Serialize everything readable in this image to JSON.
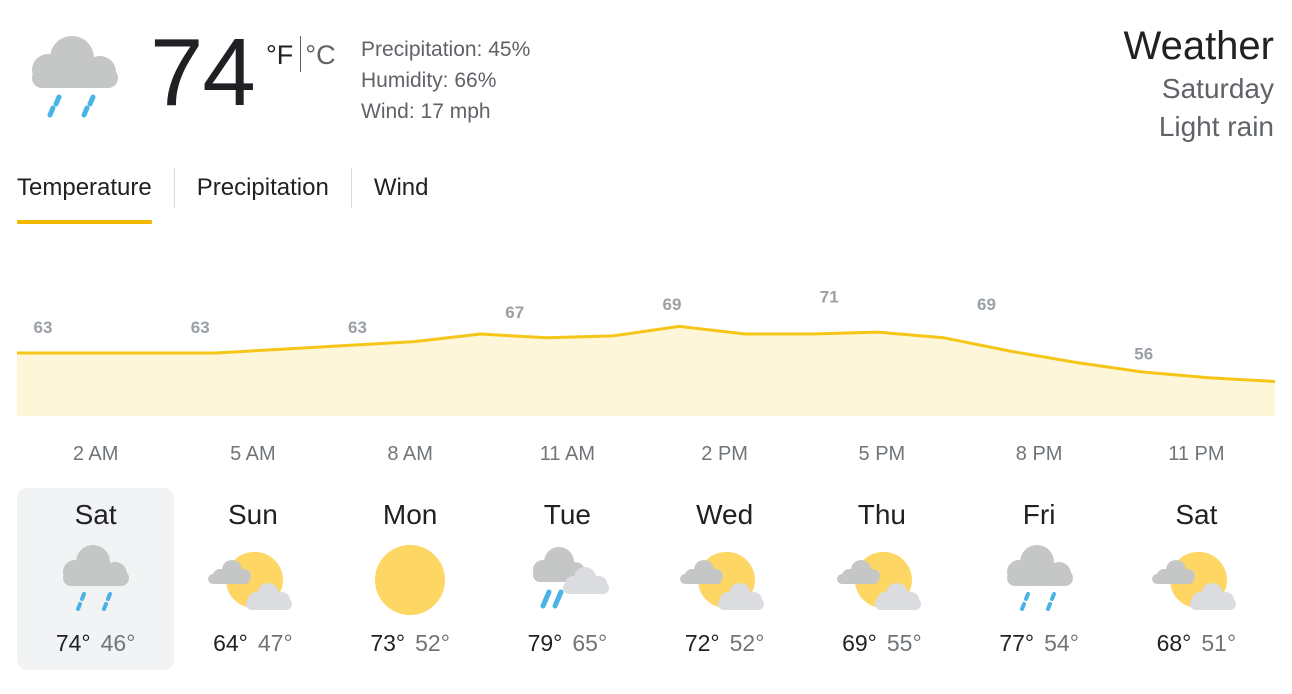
{
  "current": {
    "icon": "rain-cloud-icon",
    "temperature": "74",
    "unit_f": "°F",
    "unit_c": "°C",
    "precipitation": "Precipitation: 45%",
    "humidity": "Humidity: 66%",
    "wind": "Wind: 17 mph"
  },
  "headline": {
    "title": "Weather",
    "day": "Saturday",
    "condition": "Light rain"
  },
  "tabs": [
    {
      "label": "Temperature",
      "active": true
    },
    {
      "label": "Precipitation",
      "active": false
    },
    {
      "label": "Wind",
      "active": false
    }
  ],
  "colors": {
    "accent": "#f2b701",
    "chart_line": "#f5c518",
    "chart_fill": "#fef6d8",
    "muted_text": "#70757a",
    "sun": "#fdd663",
    "cloud": "#c4c7c5",
    "rain": "#4ab3e6",
    "selected_bg": "#f1f3f4"
  },
  "chart_data": {
    "type": "area",
    "series_name": "Temperature",
    "x": [
      "2 AM",
      "5 AM",
      "8 AM",
      "11 AM",
      "2 PM",
      "5 PM",
      "8 PM",
      "11 PM"
    ],
    "labels": [
      "63",
      "63",
      "63",
      "67",
      "69",
      "71",
      "69",
      "56"
    ],
    "values": [
      63,
      63,
      63,
      67,
      69,
      71,
      69,
      56
    ],
    "line_points_y": [
      63,
      63,
      63,
      63,
      64,
      65,
      66,
      68,
      67,
      67.5,
      70,
      68,
      68,
      68.5,
      67,
      63.5,
      60.5,
      58,
      56.5,
      55.5
    ]
  },
  "days": [
    {
      "name": "Sat",
      "icon": "rain-cloud-icon",
      "high": "74°",
      "low": "46°",
      "selected": true
    },
    {
      "name": "Sun",
      "icon": "partly-cloudy-night-icon",
      "high": "64°",
      "low": "47°",
      "selected": false
    },
    {
      "name": "Mon",
      "icon": "sun-icon",
      "high": "73°",
      "low": "52°",
      "selected": false
    },
    {
      "name": "Tue",
      "icon": "rain-and-clouds-icon",
      "high": "79°",
      "low": "65°",
      "selected": false
    },
    {
      "name": "Wed",
      "icon": "partly-cloudy-night-icon",
      "high": "72°",
      "low": "52°",
      "selected": false
    },
    {
      "name": "Thu",
      "icon": "partly-cloudy-night-icon",
      "high": "69°",
      "low": "55°",
      "selected": false
    },
    {
      "name": "Fri",
      "icon": "rain-cloud-icon",
      "high": "77°",
      "low": "54°",
      "selected": false
    },
    {
      "name": "Sat",
      "icon": "partly-cloudy-night-icon",
      "high": "68°",
      "low": "51°",
      "selected": false
    }
  ]
}
